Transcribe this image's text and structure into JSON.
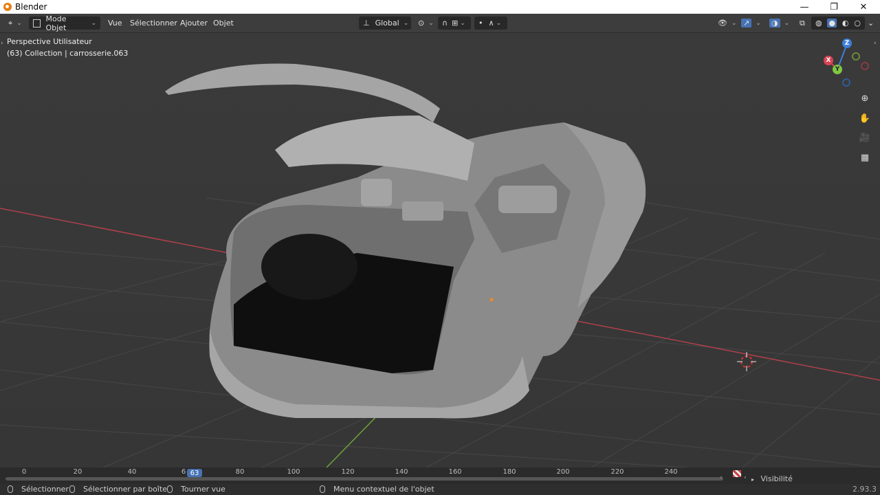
{
  "window": {
    "title": "Blender"
  },
  "header": {
    "mode": "Mode Objet",
    "menus": [
      "Vue",
      "Sélectionner",
      "Ajouter",
      "Objet"
    ],
    "orientation": "Global"
  },
  "viewport": {
    "view_name": "Perspective Utilisateur",
    "object_info": "(63) Collection | carrosserie.063",
    "gizmo": {
      "z": "Z",
      "x": "X",
      "y": "Y"
    }
  },
  "timeline": {
    "ticks": [
      "0",
      "20",
      "40",
      "6",
      "80",
      "100",
      "120",
      "140",
      "160",
      "180",
      "200",
      "220",
      "240"
    ],
    "current_frame": "63",
    "visibility": "Visibilité"
  },
  "statusbar": {
    "select": "Sélectionner",
    "box_select": "Sélectionner par boîte",
    "rotate": "Tourner vue",
    "context_menu": "Menu contextuel de l'objet",
    "version": "2.93.3"
  },
  "colors": {
    "x_axis": "#d94452",
    "y_axis": "#7ec843",
    "z_axis": "#3d7fd9",
    "current_frame": "#4772b3"
  }
}
